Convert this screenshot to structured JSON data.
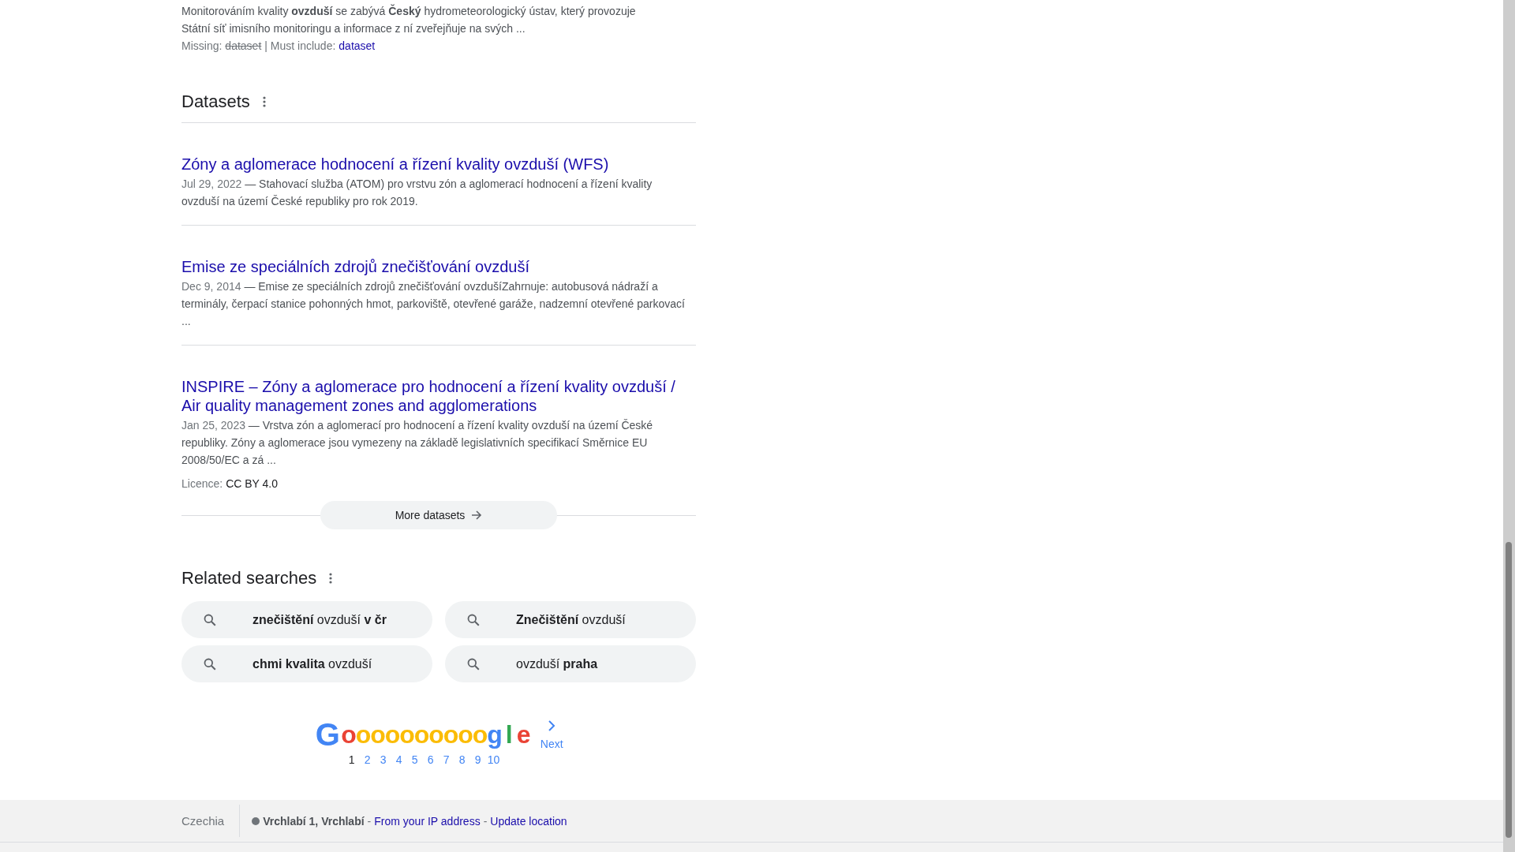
{
  "top_result": {
    "snippet": "Monitorováním kvality **ovzduší** se zabývá **Český** hydrometeorologický ústav, který provozuje Státní síť imisního monitoringu a informace z ní zveřejňuje na svých ...",
    "missing_label": "Missing:",
    "missing_term": "dataset",
    "must_include_label": "| Must include:",
    "must_include_term": "dataset"
  },
  "datasets": {
    "title": "Datasets",
    "items": [
      {
        "title": "Zóny a aglomerace hodnocení a řízení kvality ovzduší (WFS)",
        "date": "Jul 29, 2022",
        "dash": "—",
        "snippet": "Stahovací služba (ATOM) pro vrstvu zón a aglomerací hodnocení a řízení kvality ovzduší na území České republiky pro rok 2019."
      },
      {
        "title": "Emise ze speciálních zdrojů znečišťování ovzduší",
        "date": "Dec 9, 2014",
        "dash": "—",
        "snippet": "Emise ze speciálních zdrojů znečišťování ovzdušíZahrnuje: autobusová nádraží a terminály, čerpací stanice pohonných hmot, parkoviště, otevřené garáže, nadzemní otevřené parkovací ..."
      },
      {
        "title": "INSPIRE – Zóny a aglomerace pro hodnocení a řízení kvality ovzduší / Air quality management zones and agglomerations",
        "date": "Jan 25, 2023",
        "dash": "—",
        "snippet": "Vrstva zón a aglomerací pro hodnocení a řízení kvality ovzduší na území České republiky. Zóny a aglomerace jsou vymezeny na základě legislativních specifikací Směrnice EU 2008/50/EC a zá ...",
        "licence": {
          "label": "Licence:",
          "value": "CC BY 4.0"
        }
      }
    ],
    "more_button": "More datasets"
  },
  "related_searches": {
    "title": "Related searches",
    "items": [
      "**znečištění** ovzduší **v čr**",
      "**Znečištění** ovzduší",
      "**chmi kvalita** ovzduší",
      "ovzduší **praha**"
    ]
  },
  "pagination": {
    "logo": "Goooooooooogle",
    "pages": [
      {
        "label": "1",
        "selected": true
      },
      {
        "label": "2",
        "selected": false
      },
      {
        "label": "3",
        "selected": false
      },
      {
        "label": "4",
        "selected": false
      },
      {
        "label": "5",
        "selected": false
      },
      {
        "label": "6",
        "selected": false
      },
      {
        "label": "7",
        "selected": false
      },
      {
        "label": "8",
        "selected": false
      },
      {
        "label": "9",
        "selected": false
      },
      {
        "label": "10",
        "selected": false
      }
    ],
    "next": "Next"
  },
  "footer": {
    "country": "Czechia",
    "location": "Vrchlabí 1, Vrchlabí",
    "links": [
      {
        "separator": "-",
        "label": "From your IP address"
      },
      {
        "separator": "-",
        "label": "Update location"
      }
    ]
  }
}
